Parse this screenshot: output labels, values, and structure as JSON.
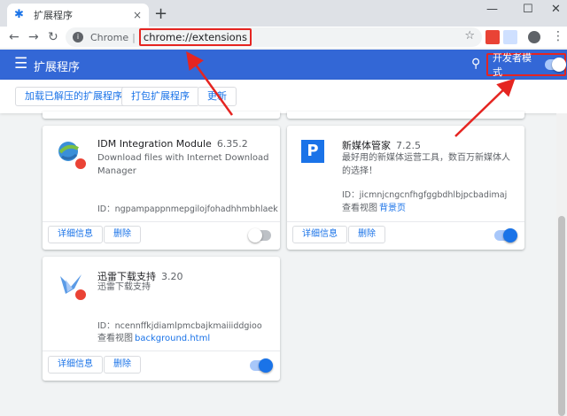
{
  "tab": {
    "title": "扩展程序",
    "favicon": "puzzle-icon",
    "close": "×"
  },
  "window": {
    "newtab": "+",
    "minimize": "—",
    "maximize": "☐",
    "close": "✕"
  },
  "toolbar": {
    "back": "←",
    "forward": "→",
    "reload": "↻",
    "chrome_label": "Chrome",
    "separator": "|",
    "url": "chrome://extensions",
    "star": "☆",
    "menu": "⋮",
    "info": "i"
  },
  "header": {
    "title": "扩展程序",
    "devmode_label": "开发者模式",
    "devmode_on": true,
    "menu": "☰",
    "search": "⚲"
  },
  "actions": {
    "load_unpacked": "加载已解压的扩展程序",
    "pack": "打包扩展程序",
    "update": "更新"
  },
  "extensions": [
    {
      "name": "IDM Integration Module",
      "version": "6.35.2",
      "description": "Download files with Internet Download Manager",
      "id": "ID：ngpampappnmepgilojfohadhhmbhlaek",
      "details": "详细信息",
      "remove": "删除",
      "enabled": false
    },
    {
      "name": "新媒体管家",
      "version": "7.2.5",
      "description": "最好用的新媒体运营工具，数百万新媒体人的选择！",
      "id": "ID：jicmnjcngcnfhgfggbdhlbjpcbadimaj",
      "views_label": "查看视图",
      "views_link": "背景页",
      "icon_letter": "P",
      "details": "详细信息",
      "remove": "删除",
      "enabled": true
    },
    {
      "name": "迅雷下载支持",
      "version": "3.20",
      "description": "迅雷下载支持",
      "id": "ID：ncennffkjdiamlpmcbajkmaiiiddgioo",
      "views_label": "查看视图",
      "views_link": "background.html",
      "details": "详细信息",
      "remove": "删除",
      "enabled": true
    }
  ],
  "colors": {
    "header": "#3367d6",
    "accent": "#1a73e8",
    "annotation": "#e52521"
  }
}
